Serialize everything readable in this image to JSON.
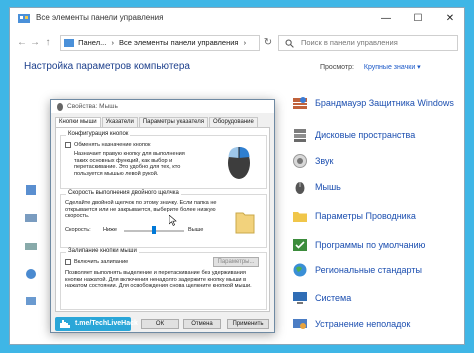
{
  "window": {
    "title": "Все элементы панели управления",
    "minimize_glyph": "—",
    "maximize_glyph": "☐",
    "close_glyph": "✕"
  },
  "address_bar": {
    "segments": [
      "Панел...",
      "›",
      "Все элементы панели управления",
      "›"
    ],
    "search_placeholder": "Поиск в панели управления"
  },
  "page": {
    "header": "Настройка параметров компьютера",
    "view_by_label": "Просмотр:",
    "view_by_value": "Крупные значки ▾"
  },
  "items": [
    {
      "label": "Брандмауэр Защитника Windows",
      "icon": "firewall-icon"
    },
    {
      "label": "Дисковые пространства",
      "icon": "storage-spaces-icon"
    },
    {
      "label": "Звук",
      "icon": "sound-icon"
    },
    {
      "label": "Мышь",
      "icon": "mouse-icon"
    },
    {
      "label": "Параметры Проводника",
      "icon": "folder-options-icon"
    },
    {
      "label": "Программы по умолчанию",
      "icon": "default-programs-icon"
    },
    {
      "label": "Региональные стандарты",
      "icon": "region-icon"
    },
    {
      "label": "Система",
      "icon": "system-icon"
    },
    {
      "label": "Устранение неполадок",
      "icon": "troubleshooting-icon"
    }
  ],
  "dialog": {
    "title": "Свойства: Мышь",
    "tabs": [
      "Кнопки мыши",
      "Указатели",
      "Параметры указателя",
      "Оборудование"
    ],
    "buttons_config": {
      "group_label": "Конфигурация кнопок",
      "checkbox_label": "Обменять назначение кнопок",
      "description": "Назначает правую кнопку для выполнения таких основных функций, как выбор и перетаскивание. Это удобно для тех, кто пользуется мышью левой рукой."
    },
    "double_click": {
      "group_label": "Скорость выполнения двойного щелчка",
      "description": "Сделайте двойной щелчок по этому значку. Если папка не открывается или не закрывается, выберите более низкую скорость.",
      "speed_label": "Скорость:",
      "slow_label": "Ниже",
      "fast_label": "Выше",
      "speed_fraction": 0.5
    },
    "click_lock": {
      "group_label": "Залипание кнопки мыши",
      "checkbox_label": "Включить залипание",
      "params_button": "Параметры...",
      "description": "Позволяет выполнять выделение и перетаскивание без удерживания кнопки нажатой. Для включения ненадолго задержите кнопку мыши в нажатом состоянии. Для освобождения снова щелкните кнопкой мыши."
    },
    "ok_button": "ОК",
    "cancel_button": "Отмена",
    "apply_button": "Применить"
  },
  "watermark": {
    "text": "t.me/TechLiveHack"
  },
  "colors": {
    "desktop": "#3fb6e6",
    "link": "#1c4fb0",
    "accent": "#0078d7",
    "watermark_bg": "#2aa6d8"
  }
}
